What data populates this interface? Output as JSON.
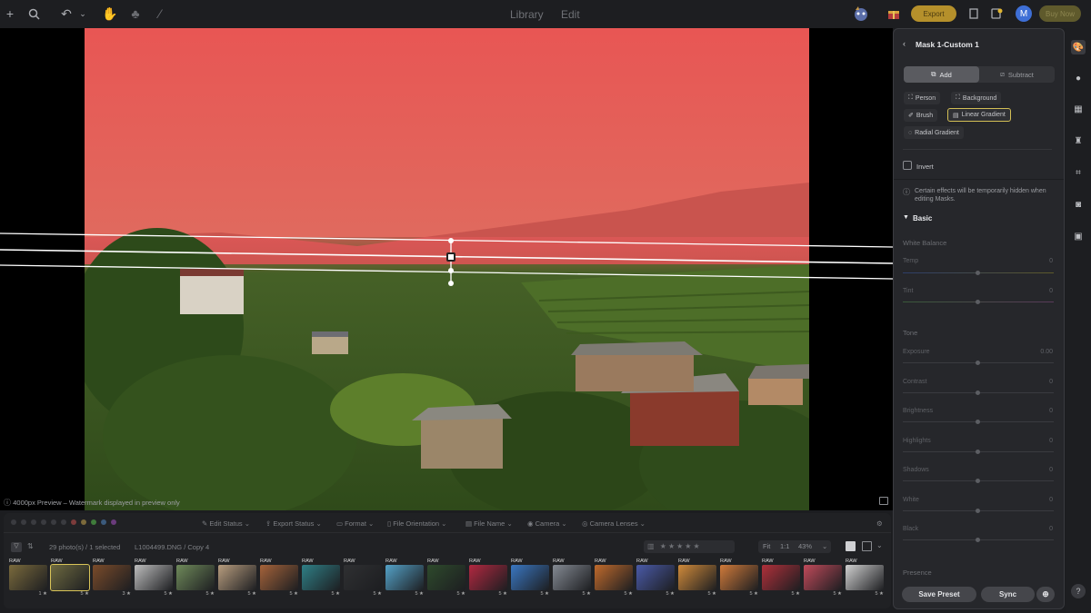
{
  "topbar": {
    "modes": [
      "Library",
      "Edit"
    ],
    "export_label": "Export",
    "buy_label": "Buy Now",
    "avatar_letter": "M"
  },
  "canvas": {
    "preview_note": "4000px Preview – Watermark displayed in preview only"
  },
  "filmstrip": {
    "filters": [
      "Edit Status",
      "Export Status",
      "Format",
      "File Orientation",
      "File Name",
      "Camera",
      "Camera Lenses"
    ],
    "count_text": "29 photo(s) / 1 selected",
    "filename": "L1004499.DNG / Copy 4",
    "zoom_fit": "Fit",
    "zoom_11": "1:1",
    "zoom_pct": "43%",
    "thumb_labels": [
      "RAW",
      "RAW",
      "RAW",
      "RAW",
      "RAW",
      "RAW",
      "RAW",
      "RAW",
      "RAW",
      "RAW",
      "RAW",
      "RAW",
      "RAW",
      "RAW",
      "RAW",
      "RAW",
      "RAW",
      "RAW",
      "RAW",
      "RAW",
      "RAW"
    ],
    "thumb_ratings": [
      "1",
      "5",
      "3",
      "5",
      "5",
      "5",
      "5",
      "5",
      "5",
      "5",
      "5",
      "5",
      "5",
      "5",
      "5",
      "5",
      "5",
      "5",
      "5",
      "5",
      "5"
    ],
    "thumb_colors": [
      "#7a6a3c",
      "#6e6a40",
      "#7a4b2a",
      "#bdbdbd",
      "#6f8a5a",
      "#b89d7e",
      "#a5633a",
      "#2f7f86",
      "#2f3032",
      "#54a2c8",
      "#2e4a2c",
      "#b22840",
      "#3a77c2",
      "#848a93",
      "#c06a2c",
      "#4a5aa8",
      "#d08a3a",
      "#d07a3a",
      "#b0303a",
      "#c04a5a",
      "#d0d0d0"
    ]
  },
  "panel": {
    "title": "Mask 1-Custom 1",
    "add_label": "Add",
    "subtract_label": "Subtract",
    "chips": [
      "Person",
      "Background",
      "Brush",
      "Linear Gradient",
      "Radial Gradient"
    ],
    "invert_label": "Invert",
    "info_text": "Certain effects will be temporarily hidden when editing Masks.",
    "section_basic": "Basic",
    "section_white_balance": "White Balance",
    "temp_label": "Temp",
    "temp_value": "0",
    "tint_label": "Tint",
    "tint_value": "0",
    "section_tone": "Tone",
    "tone_sliders": [
      {
        "label": "Exposure",
        "value": "0.00"
      },
      {
        "label": "Contrast",
        "value": "0"
      },
      {
        "label": "Brightness",
        "value": "0"
      },
      {
        "label": "Highlights",
        "value": "0"
      },
      {
        "label": "Shadows",
        "value": "0"
      },
      {
        "label": "White",
        "value": "0"
      },
      {
        "label": "Black",
        "value": "0"
      }
    ],
    "section_presence": "Presence",
    "save_preset_label": "Save Preset",
    "sync_label": "Sync"
  },
  "colors": {
    "accent_yellow": "#d2be55",
    "mask_red": "#e05858",
    "avatar_blue": "#3e6fd6"
  }
}
